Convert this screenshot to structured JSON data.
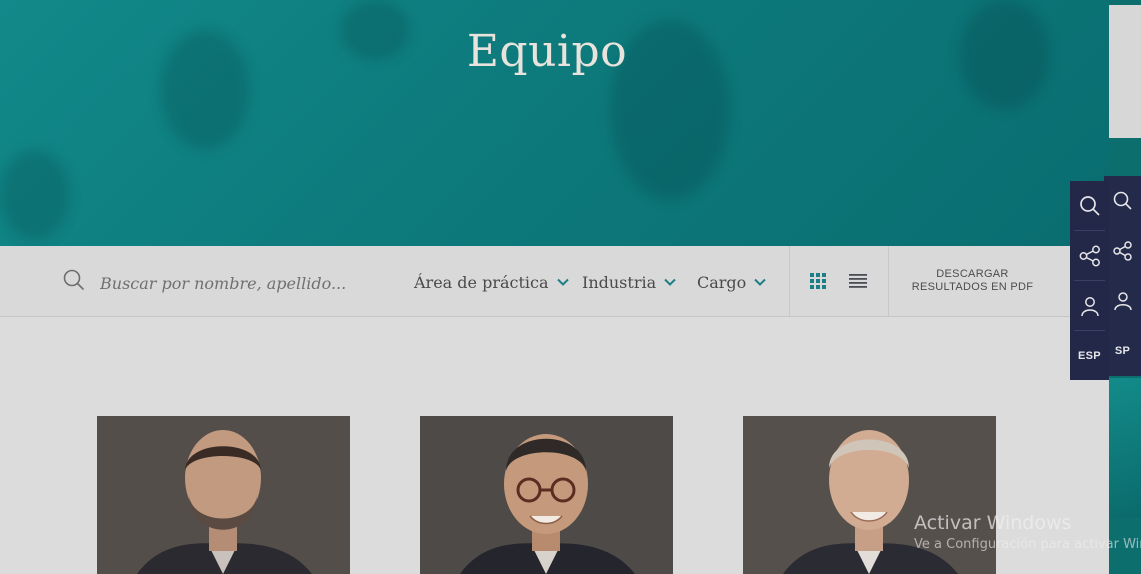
{
  "hero": {
    "title": "Equipo"
  },
  "filters": {
    "search_placeholder": "Buscar por nombre, apellido...",
    "practice_area_label": "Área de práctica",
    "industry_label": "Industria",
    "role_label": "Cargo",
    "download_pdf_line1": "DESCARGAR",
    "download_pdf_line2": "RESULTADOS EN PDF"
  },
  "views": {
    "active": "grid",
    "options": [
      "grid-icon",
      "list-icon"
    ]
  },
  "side_panel": {
    "items": [
      "search-icon",
      "share-icon",
      "people-icon"
    ],
    "language": "ESP",
    "language_partial": "SP"
  },
  "watermark": {
    "title": "Activar Windows",
    "subtitle": "Ve a Configuración para activar Windows."
  },
  "colors": {
    "accent": "#1a8a8c",
    "panel": "#232848",
    "hero_teal": "#0f7e80"
  }
}
